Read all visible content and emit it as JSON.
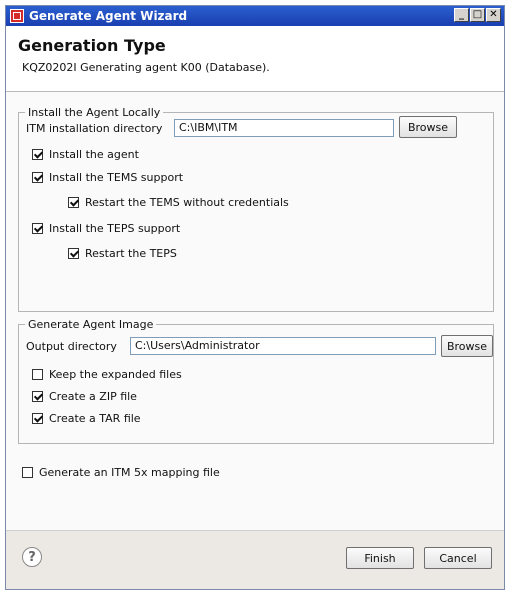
{
  "window": {
    "title": "Generate Agent Wizard",
    "minimize_glyph": "_",
    "maximize_glyph": "□",
    "close_glyph": "✕"
  },
  "header": {
    "title": "Generation Type",
    "message": "KQZ0202I Generating agent K00 (Database)."
  },
  "install_group": {
    "legend": "Install the Agent Locally",
    "dir_label": "ITM installation directory",
    "dir_value": "C:\\IBM\\ITM",
    "browse_label": "Browse",
    "checkboxes": [
      {
        "label": "Install the agent",
        "checked": true
      },
      {
        "label": "Install the TEMS support",
        "checked": true
      },
      {
        "label": "Restart the TEMS without credentials",
        "checked": true
      },
      {
        "label": "Install the TEPS support",
        "checked": true
      },
      {
        "label": "Restart the TEPS",
        "checked": true
      }
    ]
  },
  "image_group": {
    "legend": "Generate Agent Image",
    "dir_label": "Output directory",
    "dir_value": "C:\\Users\\Administrator",
    "browse_label": "Browse",
    "checkboxes": [
      {
        "label": "Keep the expanded files",
        "checked": false
      },
      {
        "label": "Create a ZIP file",
        "checked": true
      },
      {
        "label": "Create a TAR file",
        "checked": true
      }
    ]
  },
  "mapping": {
    "label": "Generate an ITM 5x mapping file",
    "checked": false
  },
  "footer": {
    "help_glyph": "?",
    "finish_label": "Finish",
    "cancel_label": "Cancel"
  }
}
